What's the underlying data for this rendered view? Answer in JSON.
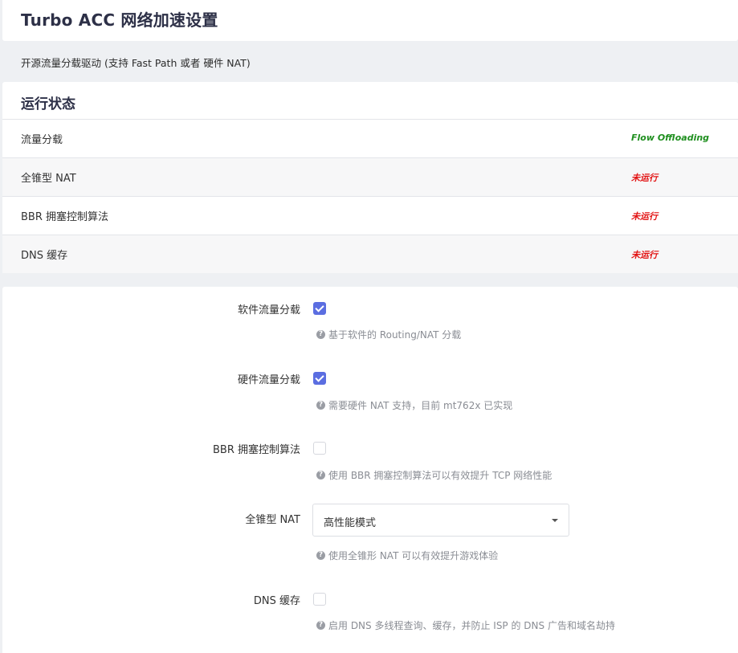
{
  "page": {
    "title": "Turbo ACC 网络加速设置",
    "description": "开源流量分载驱动 (支持 Fast Path 或者 硬件 NAT)"
  },
  "status": {
    "heading": "运行状态",
    "rows": [
      {
        "label": "流量分载",
        "value": "Flow Offloading",
        "state": "ok"
      },
      {
        "label": "全锥型 NAT",
        "value": "未运行",
        "state": "bad"
      },
      {
        "label": "BBR 拥塞控制算法",
        "value": "未运行",
        "state": "bad"
      },
      {
        "label": "DNS 缓存",
        "value": "未运行",
        "state": "bad"
      }
    ]
  },
  "colors": {
    "accent": "#5b6ee1",
    "ok": "#1f8f1f",
    "bad": "#e21111"
  },
  "form": {
    "sw_offload": {
      "label": "软件流量分载",
      "checked": true,
      "help": "基于软件的 Routing/NAT 分载"
    },
    "hw_offload": {
      "label": "硬件流量分载",
      "checked": true,
      "help": "需要硬件 NAT 支持，目前 mt762x 已实现"
    },
    "bbr": {
      "label": "BBR 拥塞控制算法",
      "checked": false,
      "help": "使用 BBR 拥塞控制算法可以有效提升 TCP 网络性能"
    },
    "fullcone": {
      "label": "全锥型 NAT",
      "selected": "高性能模式",
      "help": "使用全锥形 NAT 可以有效提升游戏体验"
    },
    "dns": {
      "label": "DNS 缓存",
      "checked": false,
      "help": "启用 DNS 多线程查询、缓存，并防止 ISP 的 DNS 广告和域名劫持"
    },
    "help_icon": "question-circle-icon"
  }
}
